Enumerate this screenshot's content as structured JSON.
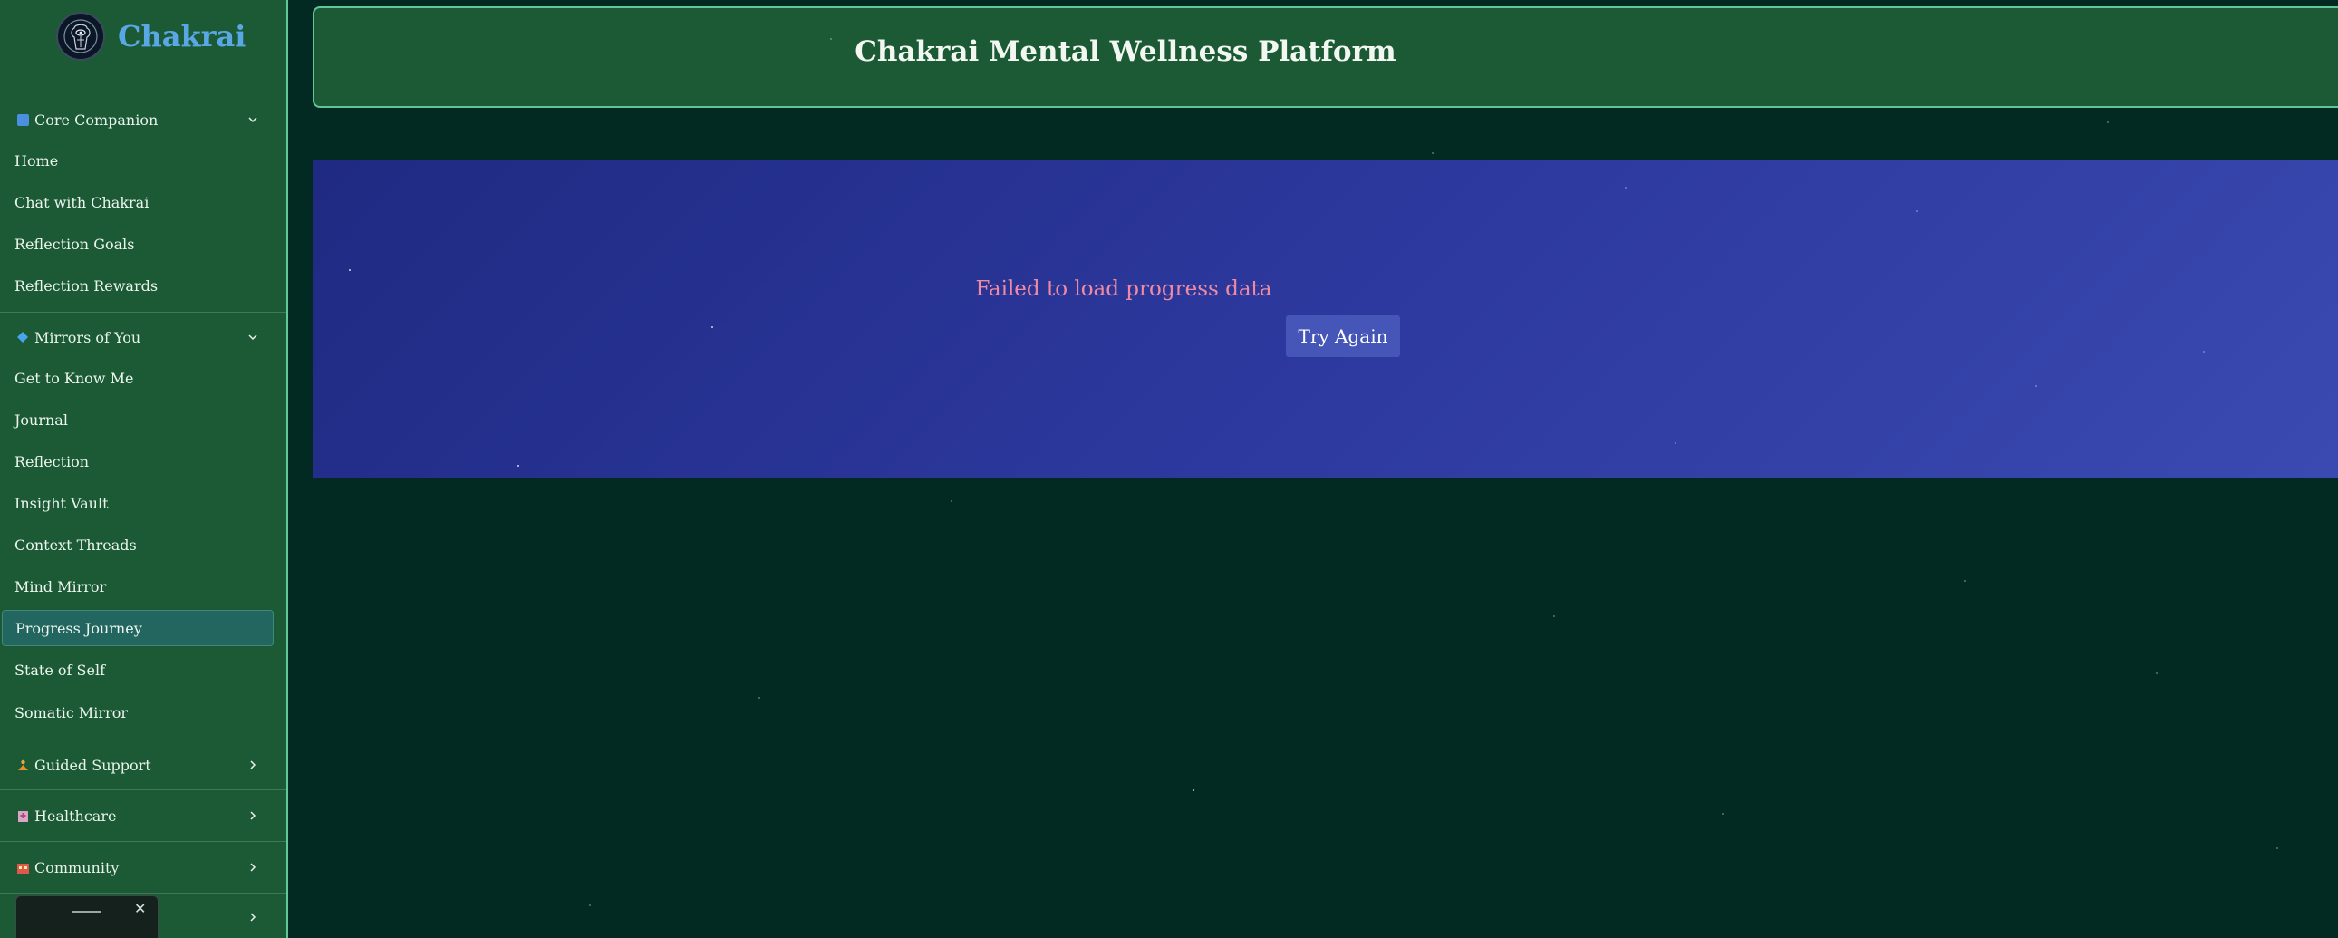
{
  "app": {
    "name": "Chakrai"
  },
  "sidebar": {
    "sections": [
      {
        "label": "Core Companion",
        "icon": "blue-square-icon",
        "expanded": true,
        "items": [
          "Home",
          "Chat with Chakrai",
          "Reflection Goals",
          "Reflection Rewards"
        ]
      },
      {
        "label": "Mirrors of You",
        "icon": "blue-diamond-icon",
        "expanded": true,
        "items": [
          "Get to Know Me",
          "Journal",
          "Reflection",
          "Insight Vault",
          "Context Threads",
          "Mind Mirror",
          "Progress Journey",
          "State of Self",
          "Somatic Mirror"
        ]
      },
      {
        "label": "Guided Support",
        "icon": "meditation-icon",
        "expanded": false
      },
      {
        "label": "Healthcare",
        "icon": "hospital-icon",
        "expanded": false
      },
      {
        "label": "Community",
        "icon": "community-building-icon",
        "expanded": false
      }
    ],
    "active_item": "Progress Journey"
  },
  "header": {
    "title": "Chakrai Mental Wellness Platform"
  },
  "progress": {
    "error_message": "Failed to load progress data",
    "retry_label": "Try Again"
  },
  "colors": {
    "sidebar_bg": "#1b5a35",
    "page_bg": "#032a22",
    "accent_border": "#5fc79a",
    "brand": "#5aa7e6",
    "panel_bg": "#2e3aa0",
    "error_text": "#f08aa2"
  }
}
